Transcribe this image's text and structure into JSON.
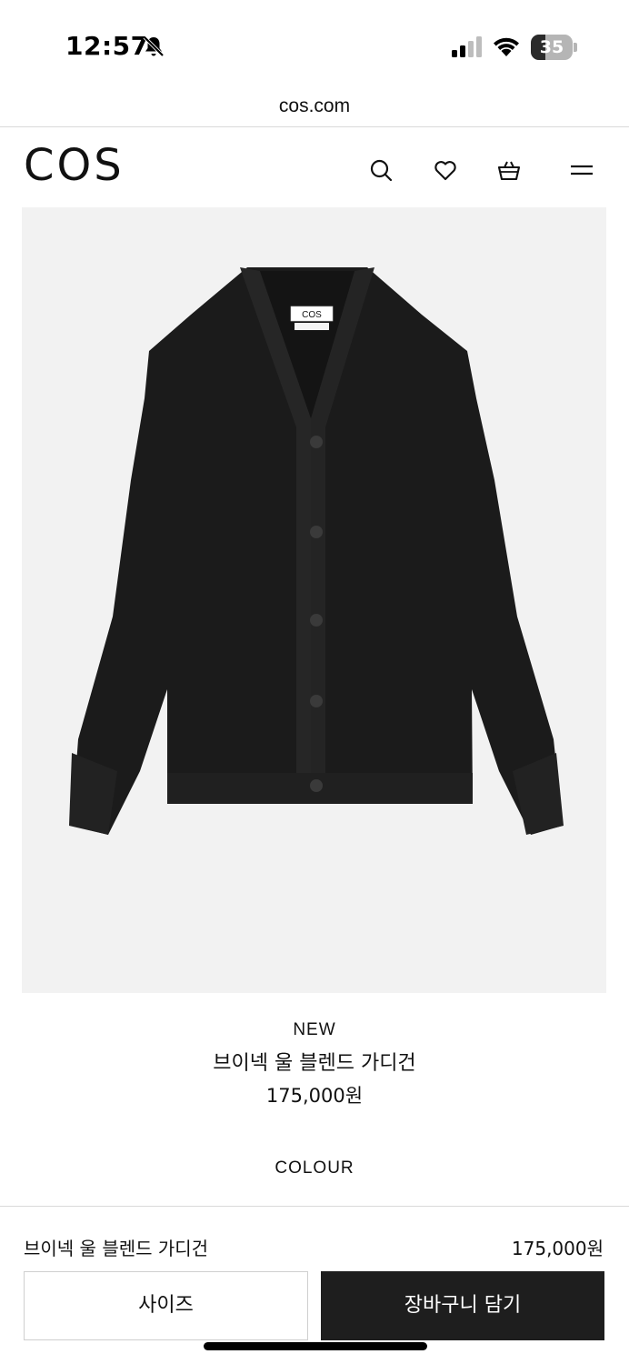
{
  "status_bar": {
    "time": "12:57",
    "battery_level": "35",
    "battery_fraction": 0.35,
    "icons": [
      "bell-slash-icon",
      "cellular-signal-icon",
      "wifi-icon",
      "battery-icon"
    ]
  },
  "browser": {
    "url": "cos.com"
  },
  "header": {
    "logo": "COS",
    "icons": [
      "search-icon",
      "heart-icon",
      "shopping-bag-icon",
      "menu-icon"
    ]
  },
  "product": {
    "image_label": "COS",
    "badge": "NEW",
    "name": "브이넥 울 블렌드 가디건",
    "price": "175,000원",
    "colour_label": "COLOUR"
  },
  "sticky_bar": {
    "name": "브이넥 울 블렌드 가디건",
    "price": "175,000원",
    "size_button": "사이즈",
    "cart_button": "장바구니 담기"
  },
  "colors": {
    "background": "#ffffff",
    "image_bg": "#f2f2f2",
    "garment": "#1b1b1b",
    "primary_button": "#1e1e1e",
    "divider": "#d9d9d9"
  }
}
